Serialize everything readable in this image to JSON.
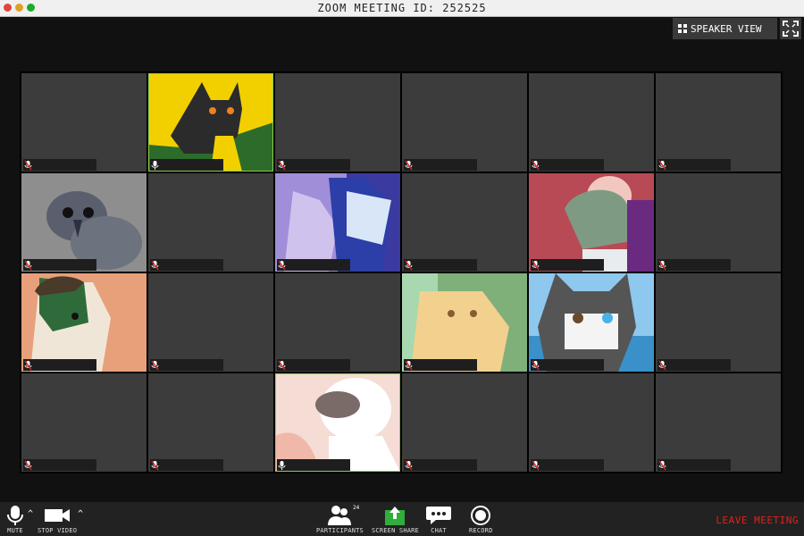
{
  "window": {
    "title": "ZOOM MEETING ID: 252525"
  },
  "header": {
    "speaker_view_label": "SPEAKER VIEW"
  },
  "tiles": [
    {
      "bg": "#3c3c3c"
    },
    {
      "bg": "#2d6b2a",
      "accent": "#f2d000",
      "active": true,
      "art": "black-cat"
    },
    {
      "bg": "#3c3c3c"
    },
    {
      "bg": "#3c3c3c"
    },
    {
      "bg": "#3c3c3c"
    },
    {
      "bg": "#3c3c3c"
    },
    {
      "bg": "#8e8e8e",
      "art": "crow"
    },
    {
      "bg": "#3c3c3c"
    },
    {
      "bg": "#3b3aa0",
      "accent": "#a18ed8",
      "art": "purple-duo"
    },
    {
      "bg": "#3c3c3c"
    },
    {
      "bg": "#b84a55",
      "accent": "#7f9a83",
      "art": "green-rat"
    },
    {
      "bg": "#3c3c3c"
    },
    {
      "bg": "#e7a07a",
      "accent": "#2f6b3a",
      "art": "masked-dog"
    },
    {
      "bg": "#3c3c3c"
    },
    {
      "bg": "#3c3c3c"
    },
    {
      "bg": "#7fb07a",
      "accent": "#f2d08e",
      "art": "cream-cat"
    },
    {
      "bg": "#8ec8ee",
      "accent": "#555",
      "art": "husky"
    },
    {
      "bg": "#3c3c3c"
    },
    {
      "bg": "#3c3c3c"
    },
    {
      "bg": "#3c3c3c"
    },
    {
      "bg": "#f5dcd5",
      "accent": "#7a6a68",
      "active": true,
      "art": "fluffy"
    },
    {
      "bg": "#3c3c3c"
    },
    {
      "bg": "#3c3c3c"
    },
    {
      "bg": "#3c3c3c"
    }
  ],
  "toolbar": {
    "mute_label": "MUTE",
    "stop_video_label": "STOP VIDEO",
    "participants_label": "PARTICIPANTS",
    "participants_count": "24",
    "screen_share_label": "SCREEN SHARE",
    "chat_label": "CHAT",
    "record_label": "RECORD",
    "leave_label": "LEAVE MEETING"
  },
  "colors": {
    "leave": "#e0221c",
    "share": "#2fae3c",
    "active_outline": "#8fd14f"
  }
}
